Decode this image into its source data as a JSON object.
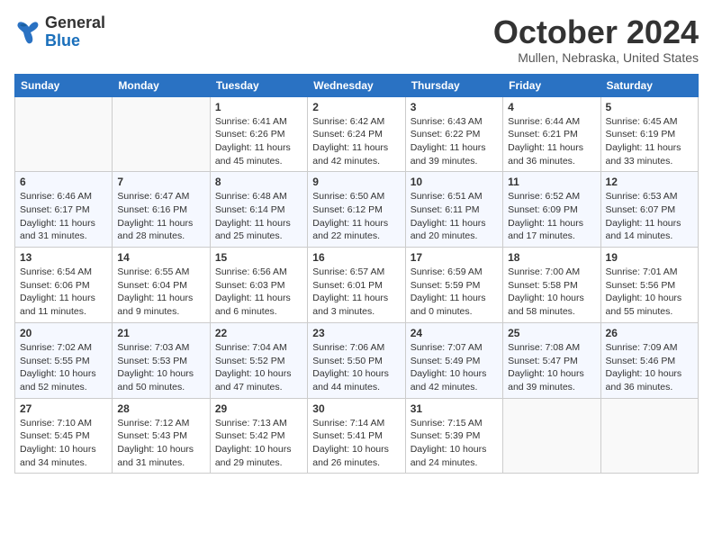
{
  "header": {
    "logo_general": "General",
    "logo_blue": "Blue",
    "month": "October 2024",
    "location": "Mullen, Nebraska, United States"
  },
  "days_of_week": [
    "Sunday",
    "Monday",
    "Tuesday",
    "Wednesday",
    "Thursday",
    "Friday",
    "Saturday"
  ],
  "weeks": [
    [
      {
        "day": "",
        "info": ""
      },
      {
        "day": "",
        "info": ""
      },
      {
        "day": "1",
        "info": "Sunrise: 6:41 AM\nSunset: 6:26 PM\nDaylight: 11 hours and 45 minutes."
      },
      {
        "day": "2",
        "info": "Sunrise: 6:42 AM\nSunset: 6:24 PM\nDaylight: 11 hours and 42 minutes."
      },
      {
        "day": "3",
        "info": "Sunrise: 6:43 AM\nSunset: 6:22 PM\nDaylight: 11 hours and 39 minutes."
      },
      {
        "day": "4",
        "info": "Sunrise: 6:44 AM\nSunset: 6:21 PM\nDaylight: 11 hours and 36 minutes."
      },
      {
        "day": "5",
        "info": "Sunrise: 6:45 AM\nSunset: 6:19 PM\nDaylight: 11 hours and 33 minutes."
      }
    ],
    [
      {
        "day": "6",
        "info": "Sunrise: 6:46 AM\nSunset: 6:17 PM\nDaylight: 11 hours and 31 minutes."
      },
      {
        "day": "7",
        "info": "Sunrise: 6:47 AM\nSunset: 6:16 PM\nDaylight: 11 hours and 28 minutes."
      },
      {
        "day": "8",
        "info": "Sunrise: 6:48 AM\nSunset: 6:14 PM\nDaylight: 11 hours and 25 minutes."
      },
      {
        "day": "9",
        "info": "Sunrise: 6:50 AM\nSunset: 6:12 PM\nDaylight: 11 hours and 22 minutes."
      },
      {
        "day": "10",
        "info": "Sunrise: 6:51 AM\nSunset: 6:11 PM\nDaylight: 11 hours and 20 minutes."
      },
      {
        "day": "11",
        "info": "Sunrise: 6:52 AM\nSunset: 6:09 PM\nDaylight: 11 hours and 17 minutes."
      },
      {
        "day": "12",
        "info": "Sunrise: 6:53 AM\nSunset: 6:07 PM\nDaylight: 11 hours and 14 minutes."
      }
    ],
    [
      {
        "day": "13",
        "info": "Sunrise: 6:54 AM\nSunset: 6:06 PM\nDaylight: 11 hours and 11 minutes."
      },
      {
        "day": "14",
        "info": "Sunrise: 6:55 AM\nSunset: 6:04 PM\nDaylight: 11 hours and 9 minutes."
      },
      {
        "day": "15",
        "info": "Sunrise: 6:56 AM\nSunset: 6:03 PM\nDaylight: 11 hours and 6 minutes."
      },
      {
        "day": "16",
        "info": "Sunrise: 6:57 AM\nSunset: 6:01 PM\nDaylight: 11 hours and 3 minutes."
      },
      {
        "day": "17",
        "info": "Sunrise: 6:59 AM\nSunset: 5:59 PM\nDaylight: 11 hours and 0 minutes."
      },
      {
        "day": "18",
        "info": "Sunrise: 7:00 AM\nSunset: 5:58 PM\nDaylight: 10 hours and 58 minutes."
      },
      {
        "day": "19",
        "info": "Sunrise: 7:01 AM\nSunset: 5:56 PM\nDaylight: 10 hours and 55 minutes."
      }
    ],
    [
      {
        "day": "20",
        "info": "Sunrise: 7:02 AM\nSunset: 5:55 PM\nDaylight: 10 hours and 52 minutes."
      },
      {
        "day": "21",
        "info": "Sunrise: 7:03 AM\nSunset: 5:53 PM\nDaylight: 10 hours and 50 minutes."
      },
      {
        "day": "22",
        "info": "Sunrise: 7:04 AM\nSunset: 5:52 PM\nDaylight: 10 hours and 47 minutes."
      },
      {
        "day": "23",
        "info": "Sunrise: 7:06 AM\nSunset: 5:50 PM\nDaylight: 10 hours and 44 minutes."
      },
      {
        "day": "24",
        "info": "Sunrise: 7:07 AM\nSunset: 5:49 PM\nDaylight: 10 hours and 42 minutes."
      },
      {
        "day": "25",
        "info": "Sunrise: 7:08 AM\nSunset: 5:47 PM\nDaylight: 10 hours and 39 minutes."
      },
      {
        "day": "26",
        "info": "Sunrise: 7:09 AM\nSunset: 5:46 PM\nDaylight: 10 hours and 36 minutes."
      }
    ],
    [
      {
        "day": "27",
        "info": "Sunrise: 7:10 AM\nSunset: 5:45 PM\nDaylight: 10 hours and 34 minutes."
      },
      {
        "day": "28",
        "info": "Sunrise: 7:12 AM\nSunset: 5:43 PM\nDaylight: 10 hours and 31 minutes."
      },
      {
        "day": "29",
        "info": "Sunrise: 7:13 AM\nSunset: 5:42 PM\nDaylight: 10 hours and 29 minutes."
      },
      {
        "day": "30",
        "info": "Sunrise: 7:14 AM\nSunset: 5:41 PM\nDaylight: 10 hours and 26 minutes."
      },
      {
        "day": "31",
        "info": "Sunrise: 7:15 AM\nSunset: 5:39 PM\nDaylight: 10 hours and 24 minutes."
      },
      {
        "day": "",
        "info": ""
      },
      {
        "day": "",
        "info": ""
      }
    ]
  ]
}
